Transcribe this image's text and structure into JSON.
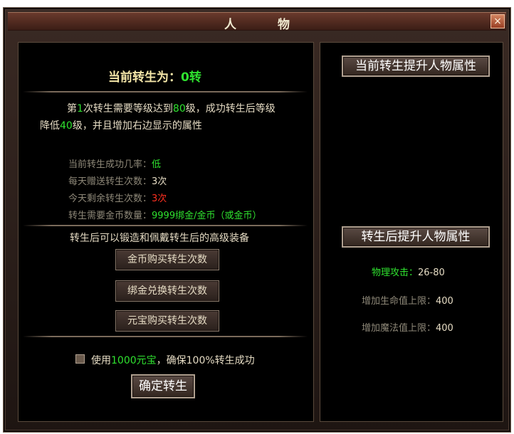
{
  "window": {
    "title": "人 物",
    "close_label": "×"
  },
  "left": {
    "current_rebirth_label": "当前转生为：",
    "current_rebirth_value": "0转",
    "requirement": {
      "p1": "第",
      "n1": "1",
      "p2": "次转生需要等级达到",
      "n2": "80",
      "p3": "级，成功转生后等级",
      "p4": "降低",
      "n3": "40",
      "p5": "级，并且增加右边显示的属性"
    },
    "stats": [
      {
        "label": "当前转生成功几率：",
        "value": "低",
        "color": "green"
      },
      {
        "label": "每天赠送转生次数：",
        "value": "3次",
        "color": "beige"
      },
      {
        "label": "今天剩余转生次数：",
        "value": "3次",
        "color": "red"
      },
      {
        "label": "转生需要金币数量：",
        "value": "9999绑金/金币（或金币）",
        "color": "green"
      }
    ],
    "equip_note": "转生后可以锻造和佩戴转生后的高级装备",
    "buttons": [
      {
        "label": "金币购买转生次数"
      },
      {
        "label": "绑金兑换转生次数"
      },
      {
        "label": "元宝购买转生次数"
      }
    ],
    "guarantee": {
      "prefix": "使用",
      "amount": "1000元宝",
      "suffix": "，确保100%转生成功",
      "checked": false
    },
    "confirm_label": "确定转生"
  },
  "right": {
    "current_header": "当前转生提升人物属性",
    "after_header": "转生后提升人物属性",
    "after_stats": [
      {
        "label": "物理攻击：",
        "value": "26-80"
      },
      {
        "label": "增加生命值上限：",
        "value": "400"
      },
      {
        "label": "增加魔法值上限：",
        "value": "400"
      }
    ]
  }
}
